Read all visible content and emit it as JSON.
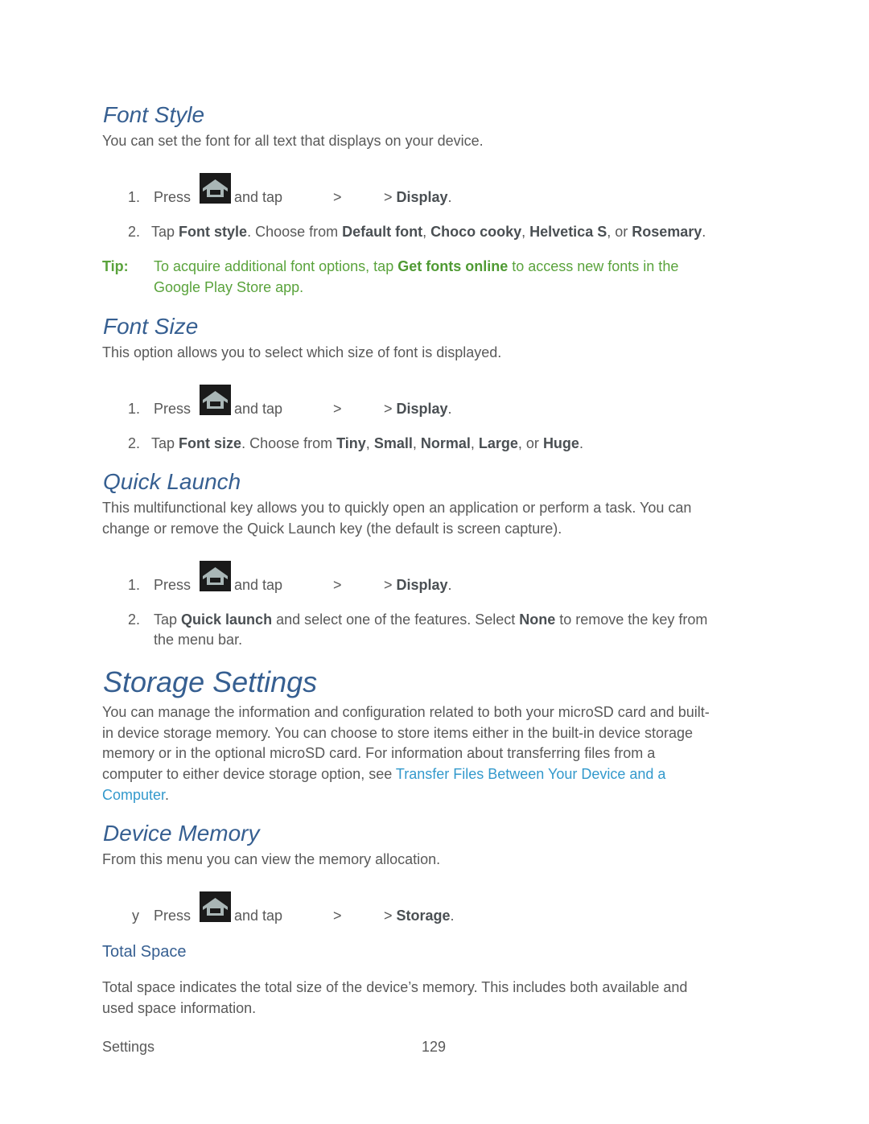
{
  "sections": {
    "font_style": {
      "heading": "Font Style",
      "intro": "You can set the font for all text that displays on your device.",
      "step1": {
        "num": "1.",
        "press": "Press",
        "and_tap": "and tap",
        "sep1": ">",
        "sep2": "> ",
        "target": "Display",
        "end": "."
      },
      "step2": {
        "num": "2.",
        "t1": "Tap ",
        "b1": "Font style",
        "t2": ". Choose from ",
        "b2": "Default font",
        "t3": ", ",
        "b3": "Choco cooky",
        "t4": ", ",
        "b4": "Helvetica S",
        "t5": ", or ",
        "b5": "Rosemary",
        "t6": "."
      },
      "tip": {
        "label": "Tip:",
        "t1": "To acquire additional font options, tap ",
        "b1": "Get fonts online",
        "t2": " to access new fonts in the",
        "line2": "Google Play Store app."
      }
    },
    "font_size": {
      "heading": "Font Size",
      "intro": "This option allows you to select which size of font is displayed.",
      "step1": {
        "num": "1.",
        "press": "Press",
        "and_tap": "and tap",
        "sep1": ">",
        "sep2": "> ",
        "target": "Display",
        "end": "."
      },
      "step2": {
        "num": "2.",
        "t1": "Tap ",
        "b1": "Font size",
        "t2": ". Choose from ",
        "b2": "Tiny",
        "t3": ", ",
        "b3": "Small",
        "t4": ", ",
        "b4": "Normal",
        "t5": ", ",
        "b5": "Large",
        "t6": ", or ",
        "b6": "Huge",
        "t7": "."
      }
    },
    "quick_launch": {
      "heading": "Quick Launch",
      "intro_line1": "This multifunctional key allows you to quickly open an application or perform a task. You can",
      "intro_line2": "change or remove the Quick Launch key (the default is screen capture).",
      "step1": {
        "num": "1.",
        "press": "Press",
        "and_tap": "and tap",
        "sep1": ">",
        "sep2": "> ",
        "target": "Display",
        "end": "."
      },
      "step2": {
        "num": "2.",
        "t1": "Tap ",
        "b1": "Quick launch",
        "t2": " and select one of the features. Select ",
        "b2": "None",
        "t3": " to remove the key from",
        "line2": "the menu bar."
      }
    },
    "storage_settings": {
      "heading": "Storage Settings",
      "line1": "You can manage the information and configuration related to both your microSD card and built-",
      "line2": "in device storage memory. You can choose to store items either in the built-in device storage",
      "line3": "memory or in the optional microSD card. For information about transferring files from a",
      "line4": "computer to either device storage option, see ",
      "link_part1": "Transfer Files Between Your Device and a",
      "link_part2": "Computer",
      "end": "."
    },
    "device_memory": {
      "heading": "Device Memory",
      "intro": "From this menu you can view the memory allocation.",
      "step1": {
        "bullet": "y",
        "press": "Press",
        "and_tap": "and tap",
        "sep1": ">",
        "sep2": "> ",
        "target": "Storage",
        "end": "."
      },
      "total_space": {
        "heading": "Total Space",
        "line1": "Total space indicates the total size of the device’s memory. This includes both available and",
        "line2": "used space information."
      }
    }
  },
  "footer": {
    "section": "Settings",
    "page": "129"
  },
  "colors": {
    "heading": "#365f91",
    "body": "#595959",
    "tip": "#5aa33c",
    "link": "#3399cc"
  }
}
